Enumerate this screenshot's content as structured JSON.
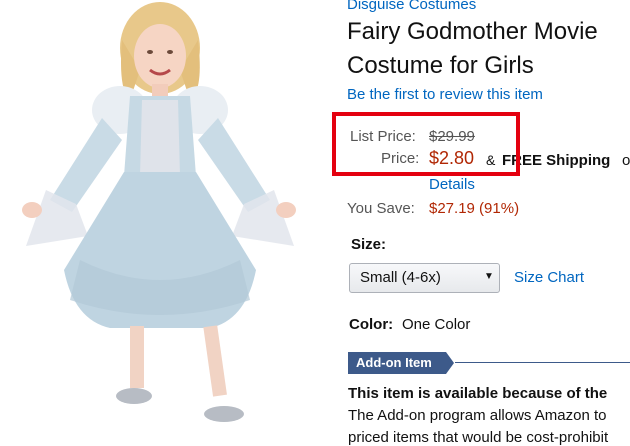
{
  "brand": "Disguise Costumes",
  "title_line1": "Fairy Godmother Movie",
  "title_line2": "Costume for Girls",
  "review_link": "Be the first to review this item",
  "list_price_label": "List Price:",
  "list_price_value": "$29.99",
  "price_label": "Price:",
  "price_value": "$2.80",
  "price_connector": "&",
  "free_shipping": "FREE Shipping",
  "shipping_trail": "o",
  "details_link": "Details",
  "you_save_label": "You Save:",
  "you_save_value": "$27.19 (91%)",
  "size_label": "Size:",
  "size_selected": "Small (4-6x)",
  "size_chart_link": "Size Chart",
  "color_label": "Color:",
  "color_value": "One Color",
  "addon_badge": "Add-on Item",
  "addon_heading": "This item is available because of the",
  "addon_text": "The Add-on program allows Amazon to",
  "addon_text_cut": "priced items that would be cost-prohibit",
  "colors": {
    "link": "#0066c0",
    "price": "#b12704",
    "highlight": "#e4000f",
    "addon": "#3d5a8a"
  }
}
